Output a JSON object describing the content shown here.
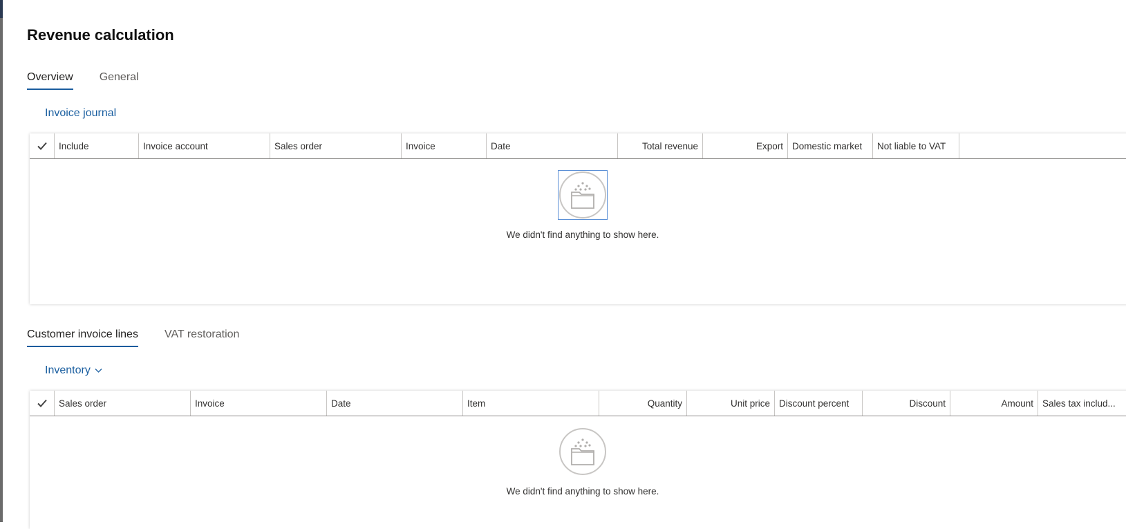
{
  "page": {
    "title": "Revenue calculation"
  },
  "top_tabs": [
    {
      "label": "Overview",
      "active": true
    },
    {
      "label": "General",
      "active": false
    }
  ],
  "invoice_section": {
    "link": "Invoice journal",
    "columns": [
      "Include",
      "Invoice account",
      "Sales order",
      "Invoice",
      "Date",
      "Total revenue",
      "Export",
      "Domestic market",
      "Not liable to VAT"
    ],
    "empty_message": "We didn't find anything to show here."
  },
  "bottom_tabs": [
    {
      "label": "Customer invoice lines",
      "active": true
    },
    {
      "label": "VAT restoration",
      "active": false
    }
  ],
  "lines_section": {
    "menu": "Inventory",
    "columns": [
      "Sales order",
      "Invoice",
      "Date",
      "Item",
      "Quantity",
      "Unit price",
      "Discount percent",
      "Discount",
      "Amount",
      "Sales tax includ..."
    ],
    "empty_message": "We didn't find anything to show here."
  },
  "icons": {
    "select_all": "checkmark-icon",
    "empty_state": "empty-folder-icon",
    "dropdown": "chevron-down-icon"
  },
  "colors": {
    "accent": "#1b5fa0",
    "tab_underline": "#1a5c9e",
    "text": "#201f1e"
  }
}
